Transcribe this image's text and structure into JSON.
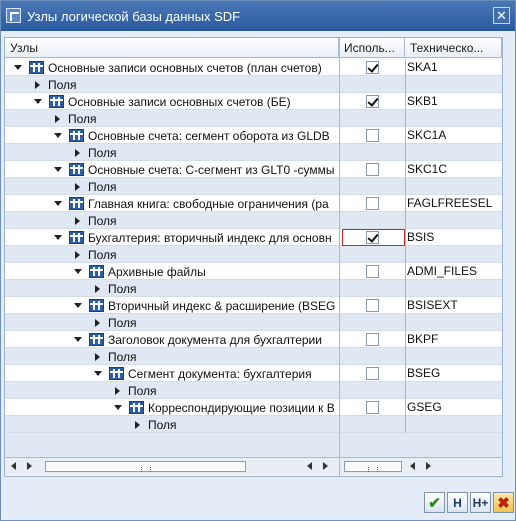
{
  "window": {
    "title": "Узлы логической базы данных SDF",
    "close_glyph": "✕"
  },
  "columns": {
    "tree": "Узлы",
    "use": "Исполь...",
    "tech": "Техническо..."
  },
  "rows": [
    {
      "label": "Основные записи основных счетов (план счетов)",
      "level": 0,
      "expander": "down",
      "icon": "table-icon",
      "use": true,
      "tech": "SKA1"
    },
    {
      "label": "Поля",
      "level": 1,
      "expander": "right",
      "icon": null,
      "use": null,
      "tech": ""
    },
    {
      "label": "Основные записи основных счетов (БЕ)",
      "level": 1,
      "expander": "down",
      "icon": "table-icon",
      "use": true,
      "tech": "SKB1"
    },
    {
      "label": "Поля",
      "level": 2,
      "expander": "right",
      "icon": null,
      "use": null,
      "tech": ""
    },
    {
      "label": "Основные счета: сегмент оборота из GLDB",
      "level": 2,
      "expander": "down",
      "icon": "table-icon",
      "use": false,
      "tech": "SKC1A"
    },
    {
      "label": "Поля",
      "level": 3,
      "expander": "right",
      "icon": null,
      "use": null,
      "tech": ""
    },
    {
      "label": "Основные счета: С-сегмент из GLT0 -суммы",
      "level": 2,
      "expander": "down",
      "icon": "table-icon",
      "use": false,
      "tech": "SKC1C"
    },
    {
      "label": "Поля",
      "level": 3,
      "expander": "right",
      "icon": null,
      "use": null,
      "tech": ""
    },
    {
      "label": "Главная книга: свободные ограничения (ра",
      "level": 2,
      "expander": "down",
      "icon": "table-icon",
      "use": false,
      "tech": "FAGLFREESEL"
    },
    {
      "label": "Поля",
      "level": 3,
      "expander": "right",
      "icon": null,
      "use": null,
      "tech": ""
    },
    {
      "label": "Бухгалтерия: вторичный индекс для основн",
      "level": 2,
      "expander": "down",
      "icon": "table-icon",
      "use": true,
      "tech": "BSIS",
      "selected": true
    },
    {
      "label": "Поля",
      "level": 3,
      "expander": "right",
      "icon": null,
      "use": null,
      "tech": ""
    },
    {
      "label": "Архивные файлы",
      "level": 3,
      "expander": "down",
      "icon": "table-icon",
      "use": false,
      "tech": "ADMI_FILES"
    },
    {
      "label": "Поля",
      "level": 4,
      "expander": "right",
      "icon": null,
      "use": null,
      "tech": ""
    },
    {
      "label": "Вторичный индекс & расширение (BSEG",
      "level": 3,
      "expander": "down",
      "icon": "table-icon",
      "use": false,
      "tech": "BSISEXT"
    },
    {
      "label": "Поля",
      "level": 4,
      "expander": "right",
      "icon": null,
      "use": null,
      "tech": ""
    },
    {
      "label": "Заголовок документа для бухгалтерии",
      "level": 3,
      "expander": "down",
      "icon": "table-icon",
      "use": false,
      "tech": "BKPF"
    },
    {
      "label": "Поля",
      "level": 4,
      "expander": "right",
      "icon": null,
      "use": null,
      "tech": ""
    },
    {
      "label": "Сегмент документа: бухгалтерия",
      "level": 4,
      "expander": "down",
      "icon": "table-icon",
      "use": false,
      "tech": "BSEG"
    },
    {
      "label": "Поля",
      "level": 5,
      "expander": "right",
      "icon": null,
      "use": null,
      "tech": ""
    },
    {
      "label": "Корреспондирующие позиции к B",
      "level": 5,
      "expander": "down",
      "icon": "table-icon",
      "use": false,
      "tech": "GSEG"
    },
    {
      "label": "Поля",
      "level": 6,
      "expander": "right",
      "icon": null,
      "use": null,
      "tech": ""
    }
  ],
  "toolbar": {
    "ok_glyph": "✔",
    "find_glyph": "H",
    "find_next_glyph": "H+",
    "cancel_glyph": "✖"
  }
}
